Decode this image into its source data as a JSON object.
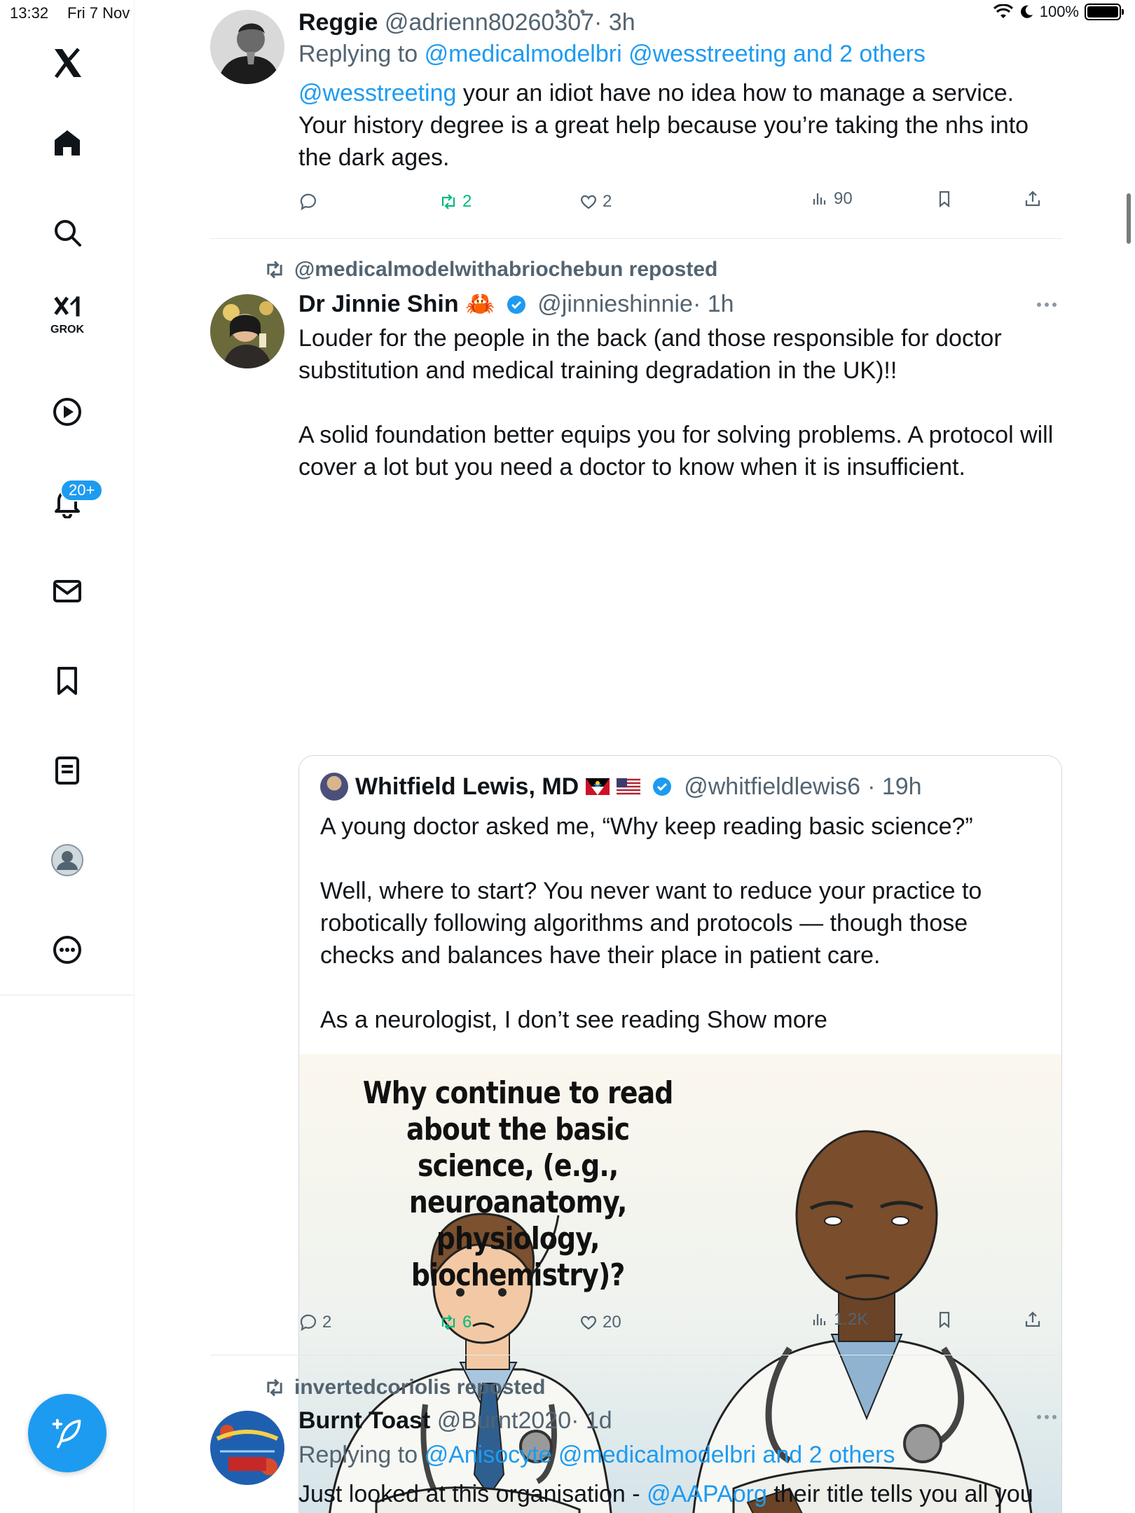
{
  "status_bar": {
    "time": "13:32",
    "date": "Fri 7 Nov",
    "battery_text": "100%",
    "battery_level": 1.0
  },
  "nav": {
    "items": [
      {
        "name": "x-logo",
        "icon": "x-logo-icon"
      },
      {
        "name": "home",
        "icon": "home-icon"
      },
      {
        "name": "search",
        "icon": "search-icon"
      },
      {
        "name": "grok",
        "icon": "grok-icon",
        "label": "GROK"
      },
      {
        "name": "video",
        "icon": "play-icon"
      },
      {
        "name": "notifications",
        "icon": "bell-icon",
        "badge": "20+"
      },
      {
        "name": "messages",
        "icon": "mail-icon"
      },
      {
        "name": "bookmarks",
        "icon": "bookmark-icon"
      },
      {
        "name": "lists",
        "icon": "list-icon"
      },
      {
        "name": "profile",
        "icon": "profile-icon"
      },
      {
        "name": "more",
        "icon": "more-icon"
      }
    ],
    "compose_icon": "compose-icon"
  },
  "colors": {
    "accent": "#1d9bf0",
    "repost_green": "#00ba7c",
    "secondary_text": "#536471"
  },
  "tweets": [
    {
      "name": "Reggie",
      "handle": "@adrienn80260307",
      "time": "· 3h",
      "reply_prefix": "Replying to",
      "reply_targets": "@medicalmodelbri @wesstreeting and 2 others",
      "mention": "@wesstreeting",
      "text": "  your an idiot have no idea how to manage a service. Your history degree is a great help because you’re taking the nhs into the dark ages.",
      "replies": "",
      "reposts": "2",
      "likes": "2",
      "views": "90"
    },
    {
      "repost_by": "@medicalmodelwithabriochebun reposted",
      "name": "Dr Jinnie Shin",
      "name_emoji": "🦀",
      "handle": "@jinnieshinnie",
      "time": "· 1h",
      "text_1": "Louder for the people in the back (and those responsible for doctor substitution and medical training degradation in the UK)!!",
      "text_2": "A solid foundation better equips you for solving problems. A protocol will cover a lot but you need a doctor to know when it is insufficient.",
      "quote": {
        "name": "Whitfield Lewis, MD",
        "handle": "@whitfieldlewis6",
        "time": "· 19h",
        "text_1": "A young doctor asked me, “Why keep reading basic science?”",
        "text_2": "Well, where to start? You never want to reduce your practice to robotically following algorithms and protocols — though those checks and balances have their place in patient care.",
        "text_3": "As a neurologist, I don’t see reading ",
        "show_more": "Show more",
        "image_caption": "Why continue to read about the basic science, (e.g., neuroanatomy, physiology, biochemistry)?"
      },
      "replies": "2",
      "reposts": "6",
      "likes": "20",
      "views": "1.2K"
    },
    {
      "repost_by": "invertedcoriolis reposted",
      "name": "Burnt Toast",
      "handle": "@Burnt2020",
      "time": "· 1d",
      "reply_prefix": "Replying to",
      "reply_targets": "@Anisocyte @medicalmodelbri and 2 others",
      "text_prefix": "Just looked at this organisation - ",
      "mention": "@AAPAorg",
      "text_suffix": " their title tells you all you"
    }
  ]
}
